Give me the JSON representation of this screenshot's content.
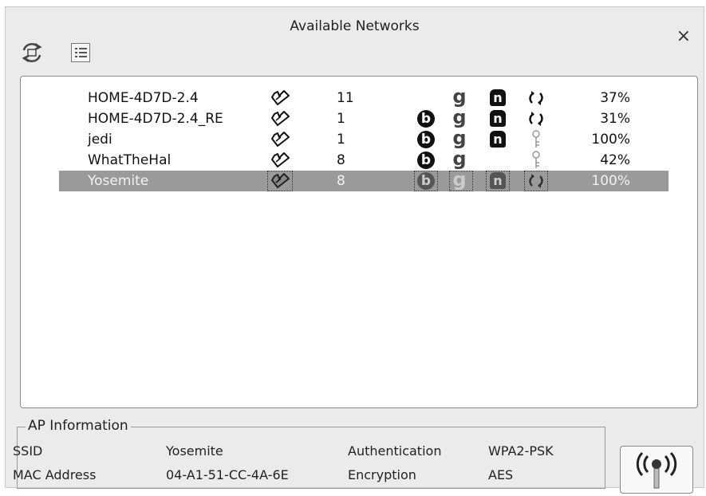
{
  "window": {
    "title": "Available Networks",
    "close_glyph": "×"
  },
  "toolbar": {
    "refresh_icon": "refresh-icon",
    "list_view_icon": "list-view-icon"
  },
  "networks": {
    "rows": [
      {
        "ssid": "HOME-4D7D-2.4",
        "channel": "11",
        "b": false,
        "g": true,
        "n": true,
        "security": "open",
        "signal": "37%",
        "selected": false
      },
      {
        "ssid": "HOME-4D7D-2.4_RE",
        "channel": "1",
        "b": true,
        "g": true,
        "n": true,
        "security": "open",
        "signal": "31%",
        "selected": false
      },
      {
        "ssid": "jedi",
        "channel": "1",
        "b": true,
        "g": true,
        "n": true,
        "security": "key",
        "signal": "100%",
        "selected": false
      },
      {
        "ssid": "WhatTheHal",
        "channel": "8",
        "b": true,
        "g": true,
        "n": false,
        "security": "key",
        "signal": "42%",
        "selected": false
      },
      {
        "ssid": "Yosemite",
        "channel": "8",
        "b": true,
        "g": true,
        "n": true,
        "security": "open",
        "signal": "100%",
        "selected": true
      }
    ],
    "badge_b": "b",
    "badge_g": "g",
    "badge_n": "n"
  },
  "ap_info": {
    "title": "AP Information",
    "ssid_label": "SSID",
    "ssid_value": "Yosemite",
    "auth_label": "Authentication",
    "auth_value": "WPA2-PSK",
    "mac_label": "MAC Address",
    "mac_value": "04-A1-51-CC-4A-6E",
    "enc_label": "Encryption",
    "enc_value": "AES"
  },
  "connect_button": {
    "icon": "wireless-antenna-icon"
  }
}
